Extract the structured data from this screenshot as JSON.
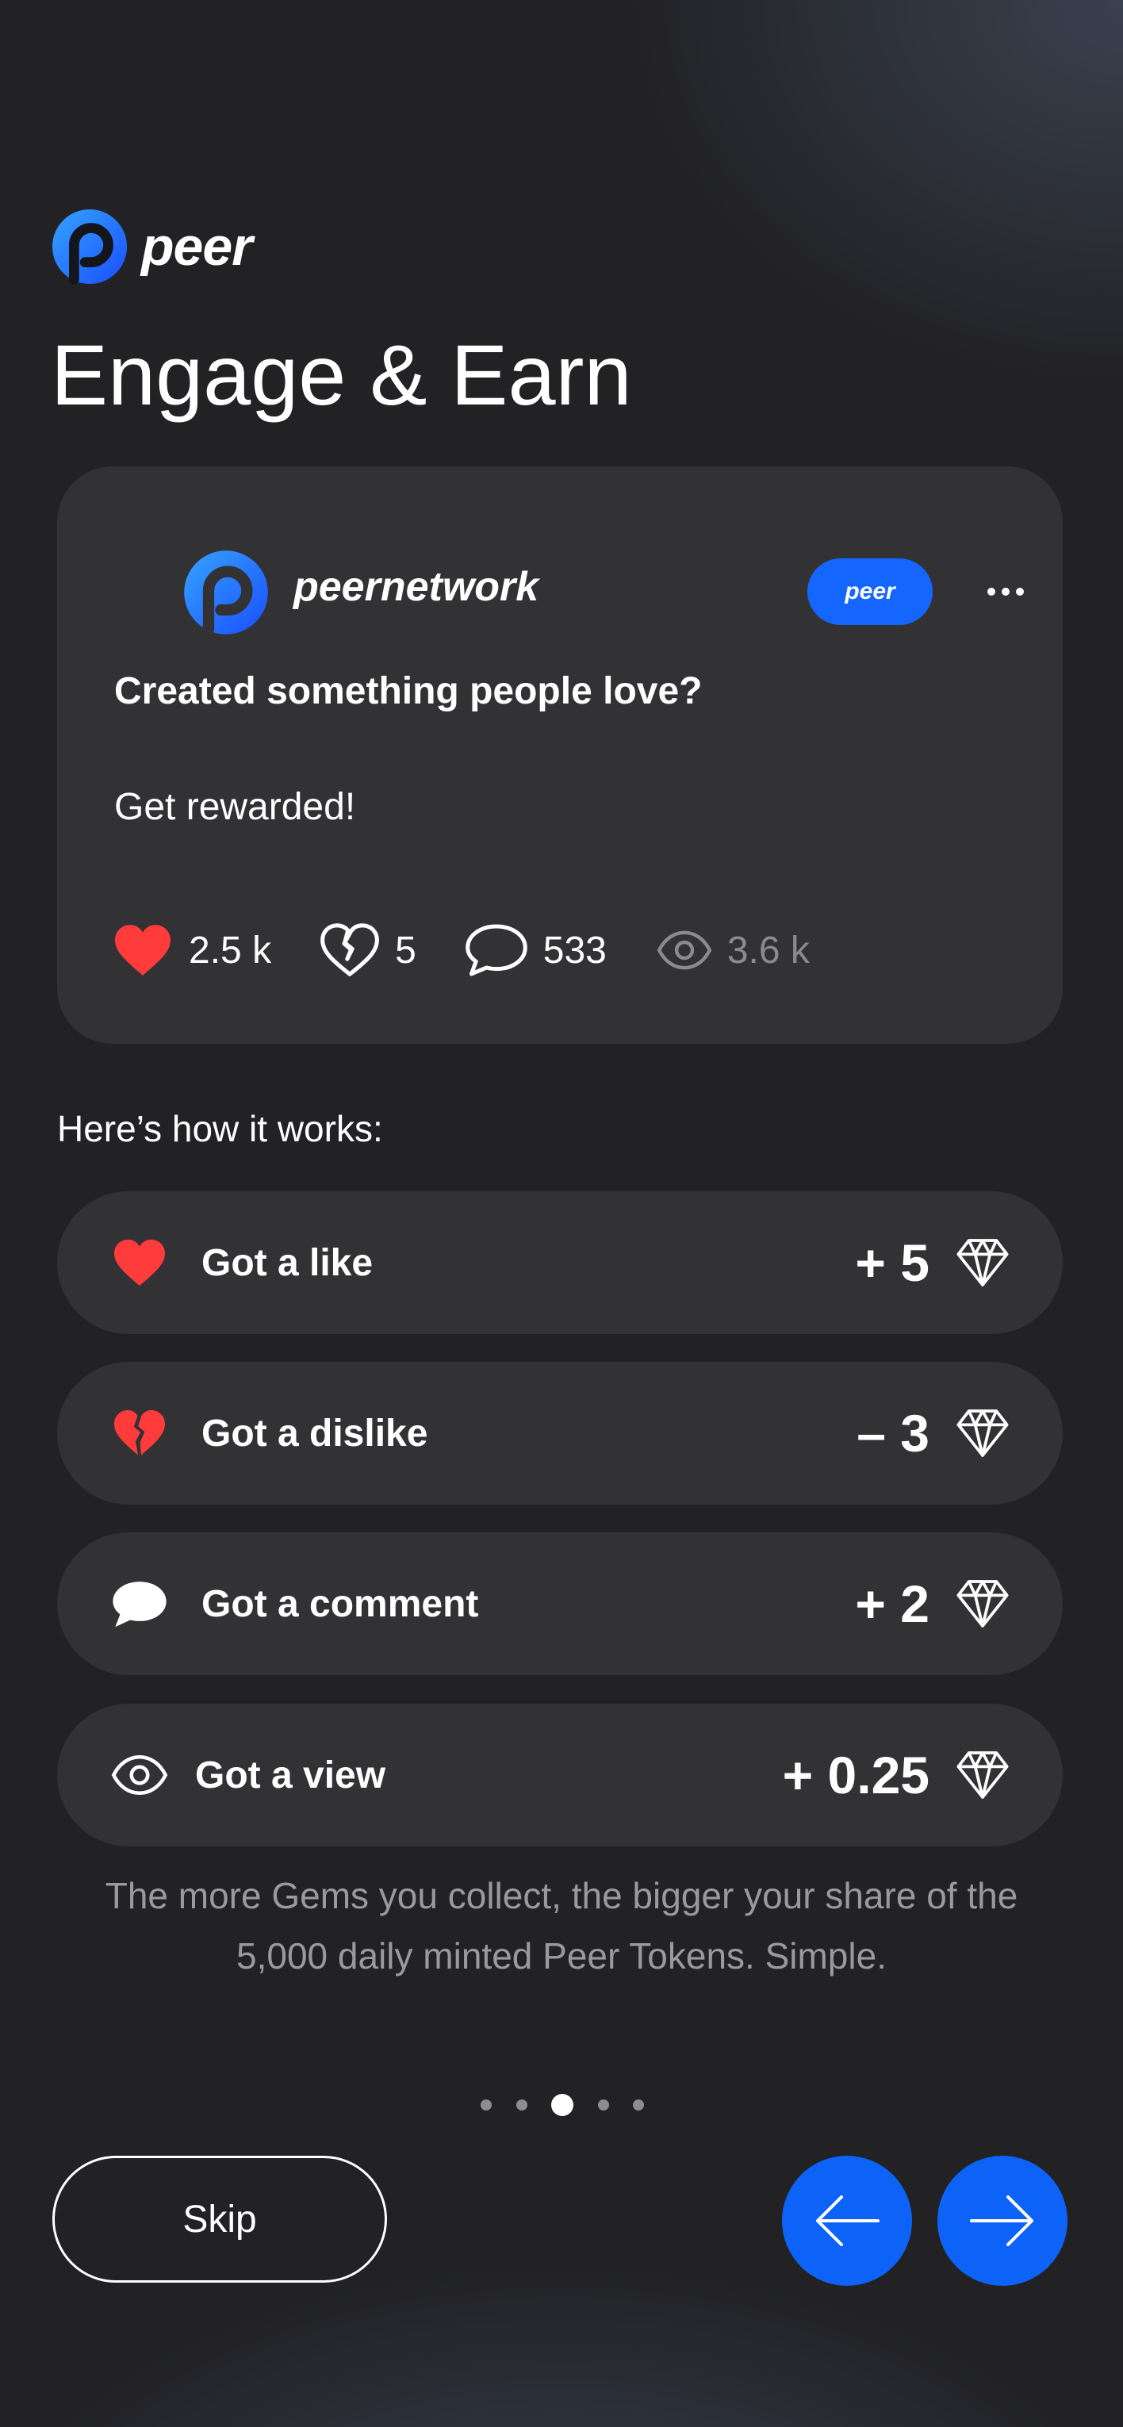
{
  "brand": {
    "name": "peer"
  },
  "title": "Engage & Earn",
  "post": {
    "username": "peernetwork",
    "badge": "peer",
    "headline": "Created something people love?",
    "body": "Get rewarded!",
    "stats": {
      "likes": "2.5 k",
      "dislikes": "5",
      "comments": "533",
      "views": "3.6 k"
    }
  },
  "how_it_works": {
    "heading": "Here’s how it works:",
    "rows": [
      {
        "label": "Got a like",
        "value": "+ 5",
        "icon": "heart-icon"
      },
      {
        "label": "Got a dislike",
        "value": "– 3",
        "icon": "broken-heart-icon"
      },
      {
        "label": "Got a comment",
        "value": "+ 2",
        "icon": "comment-icon"
      },
      {
        "label": "Got a view",
        "value": "+ 0.25",
        "icon": "eye-icon"
      }
    ],
    "gem_icon": "gem-icon"
  },
  "footnote": "The more Gems you collect, the bigger your share of the 5,000 daily minted Peer Tokens. Simple.",
  "pagination": {
    "total": 5,
    "current": 3
  },
  "buttons": {
    "skip": "Skip"
  },
  "colors": {
    "accent": "#1466ff",
    "heart": "#ff3b3b",
    "background": "#222225",
    "card": "#323234"
  }
}
